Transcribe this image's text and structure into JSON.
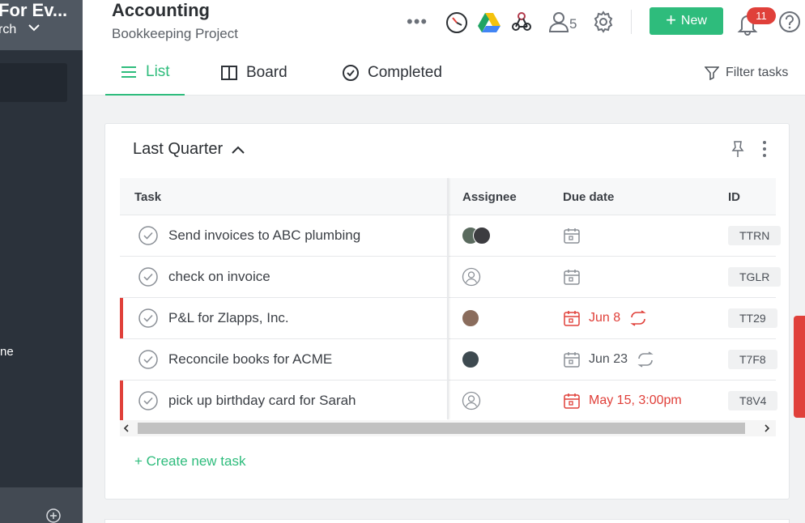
{
  "sidebar": {
    "workspace_title": "For Ev...",
    "workspace_sub": "rch",
    "item_label": "ne"
  },
  "header": {
    "title": "Accounting",
    "subtitle": "Bookkeeping Project",
    "members_count": "5",
    "new_button": "New",
    "notifications_count": "11"
  },
  "tabs": {
    "list": "List",
    "board": "Board",
    "completed": "Completed",
    "filter": "Filter tasks"
  },
  "section": {
    "title": "Last Quarter",
    "columns": {
      "task": "Task",
      "assignee": "Assignee",
      "due": "Due date",
      "id": "ID"
    },
    "rows": [
      {
        "name": "Send invoices to ABC plumbing",
        "due": "",
        "id": "TTRN"
      },
      {
        "name": "check on invoice",
        "due": "",
        "id": "TGLR"
      },
      {
        "name": "P&L for Zlapps, Inc.",
        "due": "Jun 8",
        "id": "TT29"
      },
      {
        "name": "Reconcile books for ACME",
        "due": "Jun 23",
        "id": "T7F8"
      },
      {
        "name": "pick up birthday card for Sarah",
        "due": "May 15, 3:00pm",
        "id": "T8V4"
      }
    ],
    "create_task": "+ Create new task"
  },
  "colors": {
    "accent": "#2ebc7c",
    "overdue": "#e0403a",
    "sidebar": "#2b323b"
  }
}
